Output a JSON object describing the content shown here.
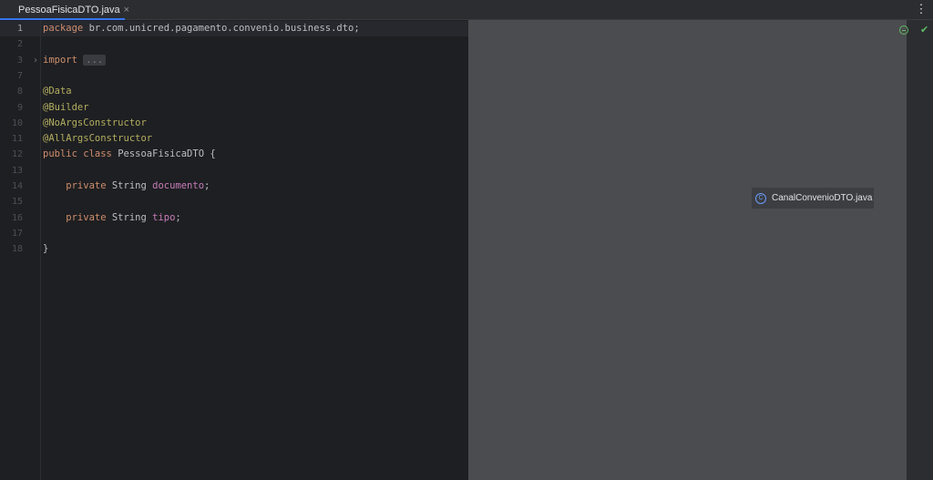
{
  "tabs": [
    {
      "label": "PessoaFisicaDTO.java",
      "active": true,
      "close_glyph": "×"
    }
  ],
  "menu_glyph": "⋮",
  "editor": {
    "lines": [
      {
        "n": "1",
        "tokens": [
          {
            "t": "package ",
            "c": "kw"
          },
          {
            "t": "br.com.unicred.pagamento.convenio.business.dto;",
            "c": ""
          }
        ]
      },
      {
        "n": "2",
        "tokens": []
      },
      {
        "n": "3",
        "fold": true,
        "tokens": [
          {
            "t": "import ",
            "c": "kw"
          },
          {
            "t": "...",
            "c": "fold-dots"
          }
        ]
      },
      {
        "n": "7",
        "tokens": []
      },
      {
        "n": "8",
        "tokens": [
          {
            "t": "@Data",
            "c": "ann"
          }
        ]
      },
      {
        "n": "9",
        "tokens": [
          {
            "t": "@Builder",
            "c": "ann"
          }
        ]
      },
      {
        "n": "10",
        "tokens": [
          {
            "t": "@NoArgsConstructor",
            "c": "ann"
          }
        ]
      },
      {
        "n": "11",
        "tokens": [
          {
            "t": "@AllArgsConstructor",
            "c": "ann"
          }
        ]
      },
      {
        "n": "12",
        "tokens": [
          {
            "t": "public ",
            "c": "kw"
          },
          {
            "t": "class ",
            "c": "kw"
          },
          {
            "t": "PessoaFisicaDTO {",
            "c": ""
          }
        ]
      },
      {
        "n": "13",
        "tokens": []
      },
      {
        "n": "14",
        "tokens": [
          {
            "t": "    private ",
            "c": "kw"
          },
          {
            "t": "String ",
            "c": ""
          },
          {
            "t": "documento",
            "c": "fld"
          },
          {
            "t": ";",
            "c": ""
          }
        ]
      },
      {
        "n": "15",
        "tokens": []
      },
      {
        "n": "16",
        "tokens": [
          {
            "t": "    private ",
            "c": "kw"
          },
          {
            "t": "String ",
            "c": ""
          },
          {
            "t": "tipo",
            "c": "fld"
          },
          {
            "t": ";",
            "c": ""
          }
        ]
      },
      {
        "n": "17",
        "tokens": []
      },
      {
        "n": "18",
        "tokens": [
          {
            "t": "}",
            "c": ""
          }
        ]
      }
    ],
    "fold_glyph": "›"
  },
  "drag_popup": {
    "label": "CanalConvenioDTO.java",
    "icon_glyph": "C"
  },
  "status": {
    "check_glyph": "✔"
  },
  "colors": {
    "keyword": "#cf8e6d",
    "annotation": "#b3ae60",
    "field": "#c77dbb",
    "accent": "#3574f0",
    "ok": "#5fb865"
  }
}
